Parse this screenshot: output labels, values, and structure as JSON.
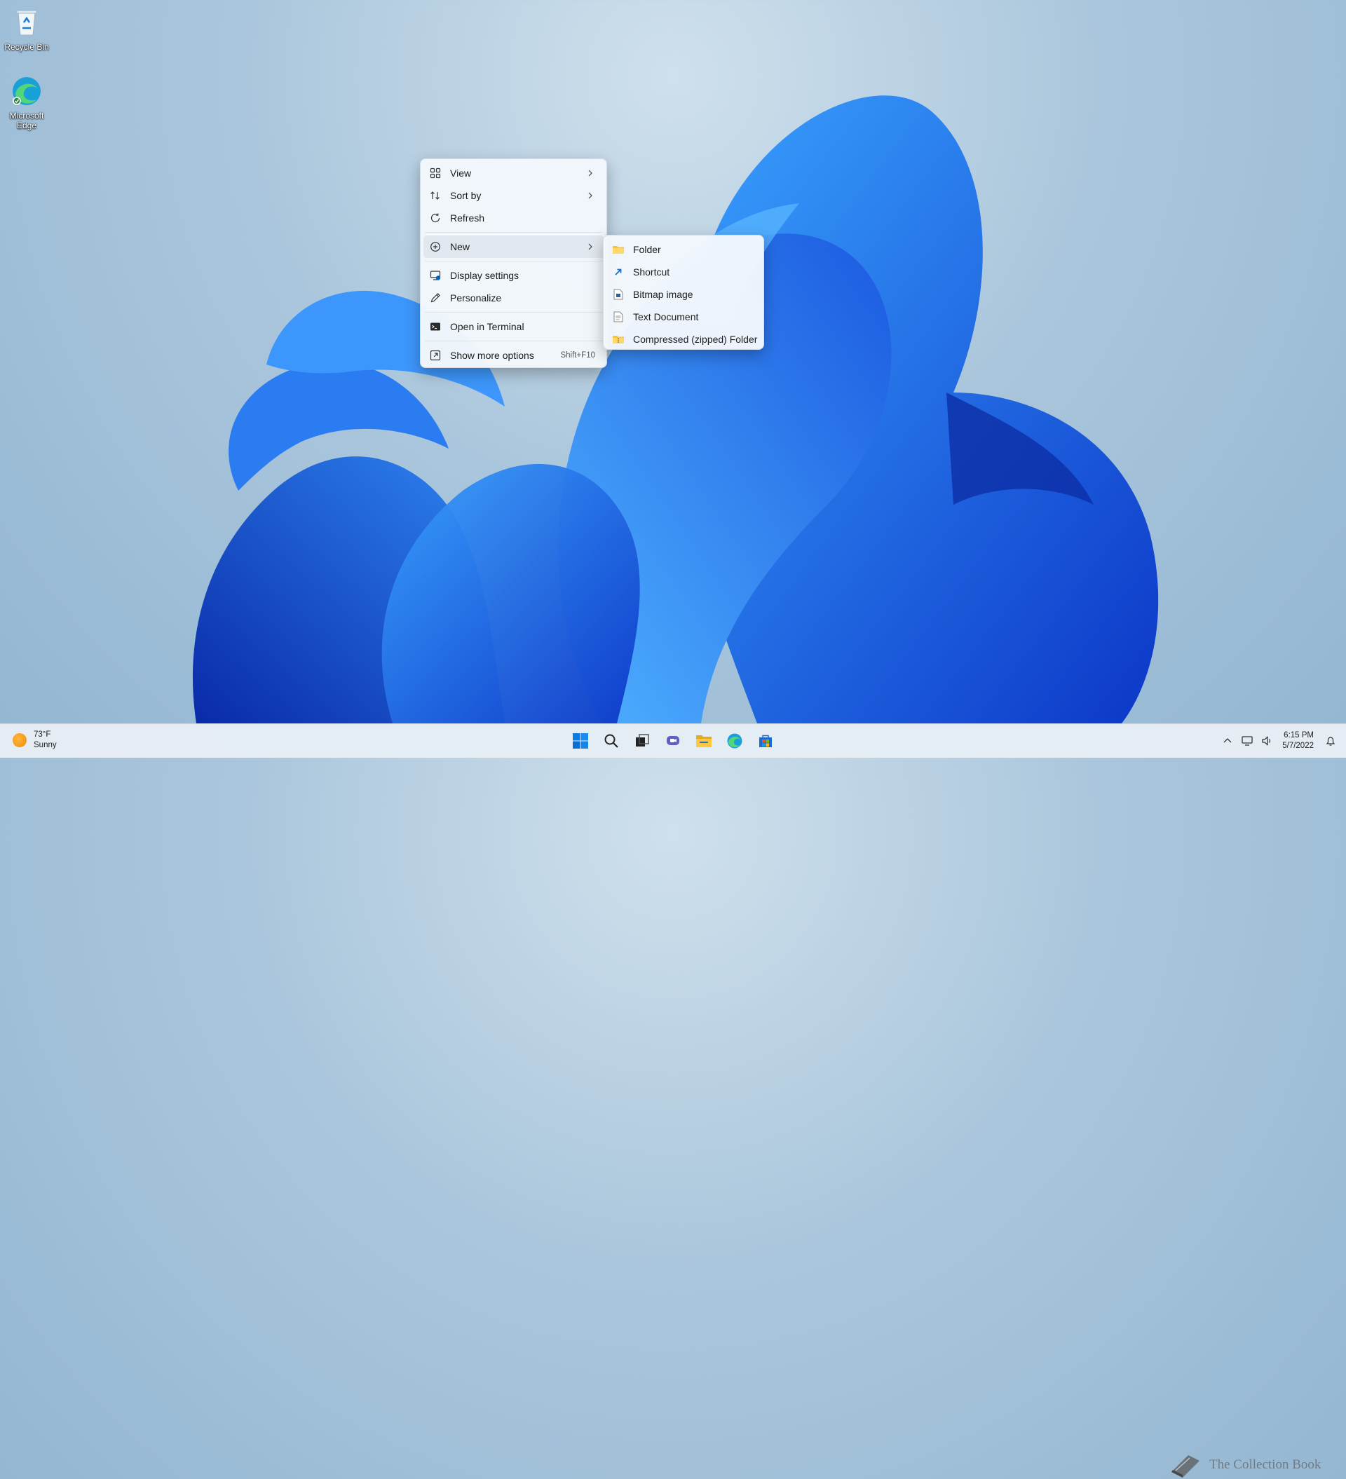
{
  "desktop": {
    "icons": [
      {
        "label": "Recycle Bin",
        "icon": "recycle-bin-icon"
      },
      {
        "label": "Microsoft\nEdge",
        "icon": "edge-icon"
      }
    ]
  },
  "context_menu": {
    "items": [
      {
        "label": "View",
        "icon": "view-grid-icon",
        "submenu": true
      },
      {
        "label": "Sort by",
        "icon": "sort-icon",
        "submenu": true
      },
      {
        "label": "Refresh",
        "icon": "refresh-icon"
      },
      {
        "label": "New",
        "icon": "plus-circle-icon",
        "submenu": true,
        "highlighted": true
      },
      {
        "label": "Display settings",
        "icon": "display-settings-icon"
      },
      {
        "label": "Personalize",
        "icon": "pen-icon"
      },
      {
        "label": "Open in Terminal",
        "icon": "terminal-icon"
      },
      {
        "label": "Show more options",
        "icon": "more-options-icon",
        "shortcut": "Shift+F10"
      }
    ]
  },
  "new_submenu": {
    "items": [
      {
        "label": "Folder",
        "icon": "folder-icon"
      },
      {
        "label": "Shortcut",
        "icon": "shortcut-icon"
      },
      {
        "label": "Bitmap image",
        "icon": "bitmap-icon"
      },
      {
        "label": "Text Document",
        "icon": "text-document-icon"
      },
      {
        "label": "Compressed (zipped) Folder",
        "icon": "zip-folder-icon"
      }
    ]
  },
  "taskbar": {
    "weather": {
      "temp": "73°F",
      "condition": "Sunny"
    },
    "pinned": [
      "start-icon",
      "search-icon",
      "task-view-icon",
      "chat-icon",
      "file-explorer-icon",
      "edge-icon",
      "store-icon"
    ],
    "tray": [
      "chevron-up-icon",
      "network-icon",
      "volume-icon"
    ],
    "clock": {
      "time": "6:15 PM",
      "date": "5/7/2022"
    }
  },
  "watermark": {
    "text": "The Collection Book"
  },
  "colors": {
    "accent": "#0067c0",
    "bloom_dark": "#0a2fb8",
    "bloom_light": "#2f8bf5"
  }
}
